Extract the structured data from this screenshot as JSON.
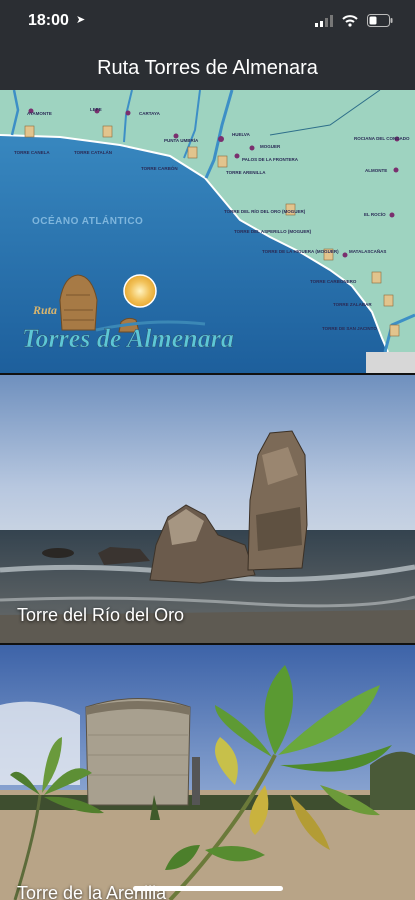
{
  "status_bar": {
    "time": "18:00"
  },
  "nav": {
    "title": "Ruta Torres de Almenara"
  },
  "map": {
    "ocean_label": "OCÉANO ATLÁNTICO",
    "logo_line1": "Ruta",
    "logo_line2": "Torres de Almenara",
    "labels": {
      "l1": "AYAMONTE",
      "l2": "LEPE",
      "l3": "CARTAYA",
      "l4": "PUNTA UMBRÍA",
      "l5": "HUELVA",
      "l6": "MOGUER",
      "l7": "PALOS DE LA FRONTERA",
      "l8": "TORRE CANELA",
      "l9": "TORRE CATALÁN",
      "l10": "TORRE CARBÓN",
      "l11": "TORRE ARENILLA",
      "l12": "TORRE DEL RÍO DEL ORO (MOGUER)",
      "l13": "TORRE DEL ASPERILLO (MOGUER)",
      "l14": "TORRE DE LA HIGUERA (MOGUER)",
      "l15": "ROCIANA DEL CONDADO",
      "l16": "ALMONTE",
      "l17": "EL ROCÍO",
      "l18": "MATALASCAÑAS",
      "l19": "TORRE CARBONERO",
      "l20": "TORRE ZALABAR",
      "l21": "TORRE DE SAN JACINTO"
    }
  },
  "cards": [
    {
      "label": "Torre del Río del Oro"
    },
    {
      "label": "Torre de la Arenilla"
    }
  ]
}
